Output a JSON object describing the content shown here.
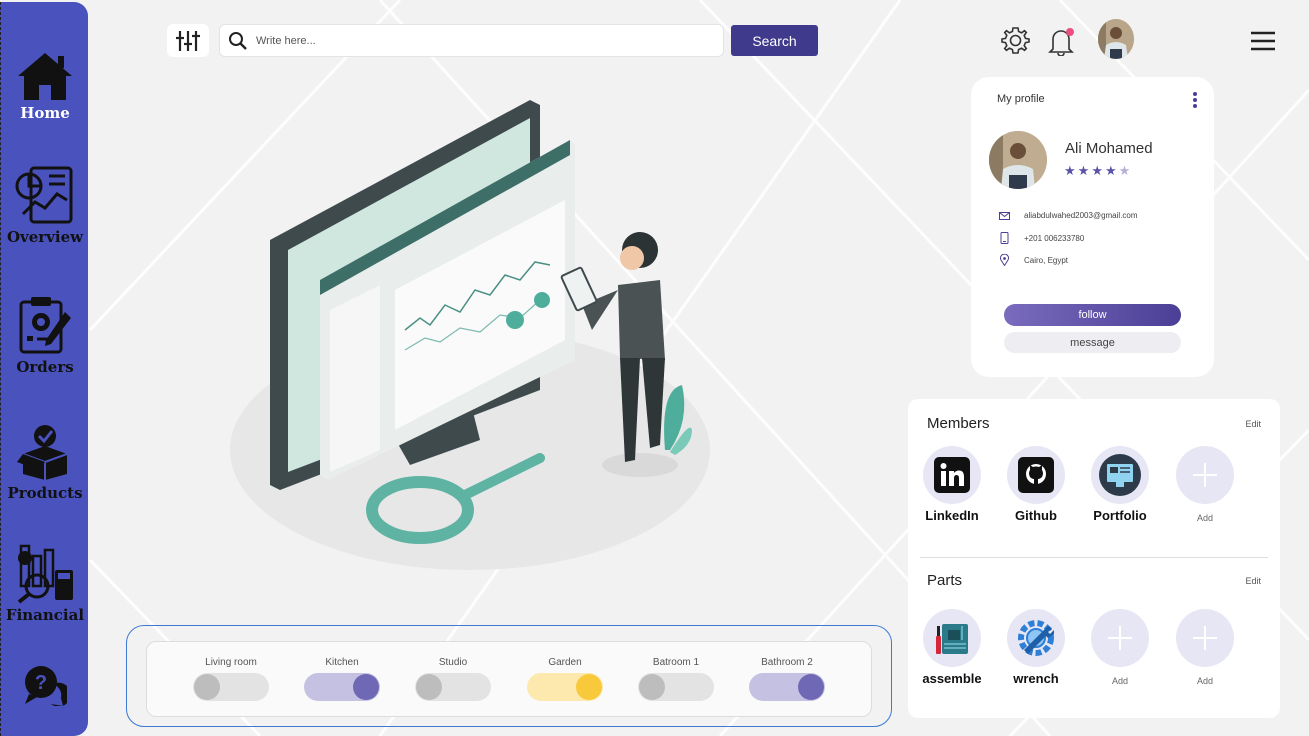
{
  "sidebar": {
    "items": [
      {
        "label": "Home",
        "icon": "home-icon"
      },
      {
        "label": "Overview",
        "icon": "overview-chart-icon"
      },
      {
        "label": "Orders",
        "icon": "orders-clipboard-icon"
      },
      {
        "label": "Products",
        "icon": "products-box-icon"
      },
      {
        "label": "Financial",
        "icon": "financial-calculator-icon"
      }
    ],
    "help_icon": "help-chat-icon"
  },
  "search": {
    "placeholder": "Write here...",
    "button_label": "Search"
  },
  "profile": {
    "title": "My profile",
    "name": "Ali Mohamed",
    "rating": 4,
    "rating_max": 5,
    "email": "aliabdulwahed2003@gmail.com",
    "phone": "+201 006233780",
    "location": "Cairo, Egypt",
    "follow_label": "follow",
    "message_label": "message"
  },
  "members": {
    "title": "Members",
    "edit_label": "Edit",
    "items": [
      {
        "label": "LinkedIn"
      },
      {
        "label": "Github"
      },
      {
        "label": "Portfolio"
      },
      {
        "label": "Add"
      }
    ]
  },
  "parts": {
    "title": "Parts",
    "edit_label": "Edit",
    "items": [
      {
        "label": "assemble"
      },
      {
        "label": "wrench"
      },
      {
        "label": "Add"
      },
      {
        "label": "Add"
      }
    ]
  },
  "rooms": [
    {
      "label": "Living room",
      "on": false
    },
    {
      "label": "Kitchen",
      "on": true
    },
    {
      "label": "Studio",
      "on": false
    },
    {
      "label": "Garden",
      "on": true
    },
    {
      "label": "Batroom 1",
      "on": false
    },
    {
      "label": "Bathroom 2",
      "on": true
    }
  ],
  "colors": {
    "sidebar": "#4a52bd",
    "search_button": "#3f3a8c",
    "toggle_on_purple": "#6f68b4",
    "toggle_on_yellow": "#f9c93c",
    "toggle_off": "#bdbdbd",
    "rooms_border": "#3d7ad6"
  }
}
